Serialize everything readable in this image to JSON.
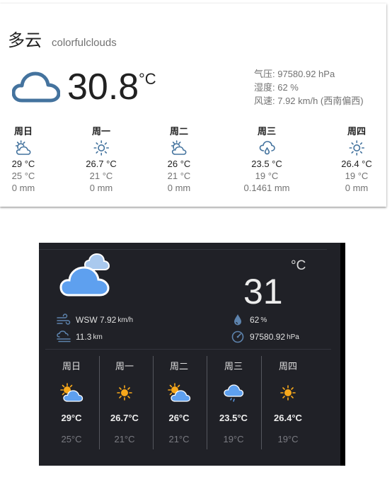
{
  "light": {
    "title": "多云",
    "subtitle": "colorfulclouds",
    "condition_icon": "cloud-icon",
    "temperature": "30.8",
    "unit": "°C",
    "attributes": [
      "气压: 97580.92 hPa",
      "湿度: 62 %",
      "风速: 7.92 km/h (西南偏西)"
    ],
    "forecast": [
      {
        "day": "周日",
        "icon": "partly-cloudy-icon",
        "high": "29 °C",
        "low": "25 °C",
        "precip": "0 mm"
      },
      {
        "day": "周一",
        "icon": "sunny-icon",
        "high": "26.7 °C",
        "low": "21 °C",
        "precip": "0 mm"
      },
      {
        "day": "周二",
        "icon": "partly-cloudy-icon",
        "high": "26 °C",
        "low": "21 °C",
        "precip": "0 mm"
      },
      {
        "day": "周三",
        "icon": "rain-icon",
        "high": "23.5 °C",
        "low": "19 °C",
        "precip": "0.1461 mm"
      },
      {
        "day": "周四",
        "icon": "sunny-icon",
        "high": "26.4 °C",
        "low": "19 °C",
        "precip": "0 mm"
      }
    ]
  },
  "dark": {
    "condition_icon": "cloudy-icon",
    "unit": "°C",
    "temperature": "31",
    "wind": {
      "icon": "wind-icon",
      "value": "WSW 7.92",
      "unit": "km/h"
    },
    "visibility": {
      "icon": "fog-icon",
      "value": "11.3",
      "unit": "km"
    },
    "humidity": {
      "icon": "water-drop-icon",
      "value": "62",
      "unit": "%"
    },
    "pressure": {
      "icon": "gauge-icon",
      "value": "97580.92",
      "unit": "hPa"
    },
    "forecast": [
      {
        "day": "周日",
        "icon": "partly-cloudy-icon",
        "high": "29°C",
        "low": "25°C"
      },
      {
        "day": "周一",
        "icon": "sunny-icon",
        "high": "26.7°C",
        "low": "21°C"
      },
      {
        "day": "周二",
        "icon": "partly-cloudy-icon",
        "high": "26°C",
        "low": "21°C"
      },
      {
        "day": "周三",
        "icon": "rain-icon",
        "high": "23.5°C",
        "low": "19°C"
      },
      {
        "day": "周四",
        "icon": "sunny-icon",
        "high": "26.4°C",
        "low": "19°C"
      }
    ],
    "colors": {
      "background": "#202127",
      "sun": "#f7a81b",
      "cloud": "#5ea0ef",
      "muted": "#7a7b82"
    }
  },
  "colors": {
    "light_icon": "#44739e",
    "text_primary": "#212121",
    "text_secondary": "#727272"
  }
}
